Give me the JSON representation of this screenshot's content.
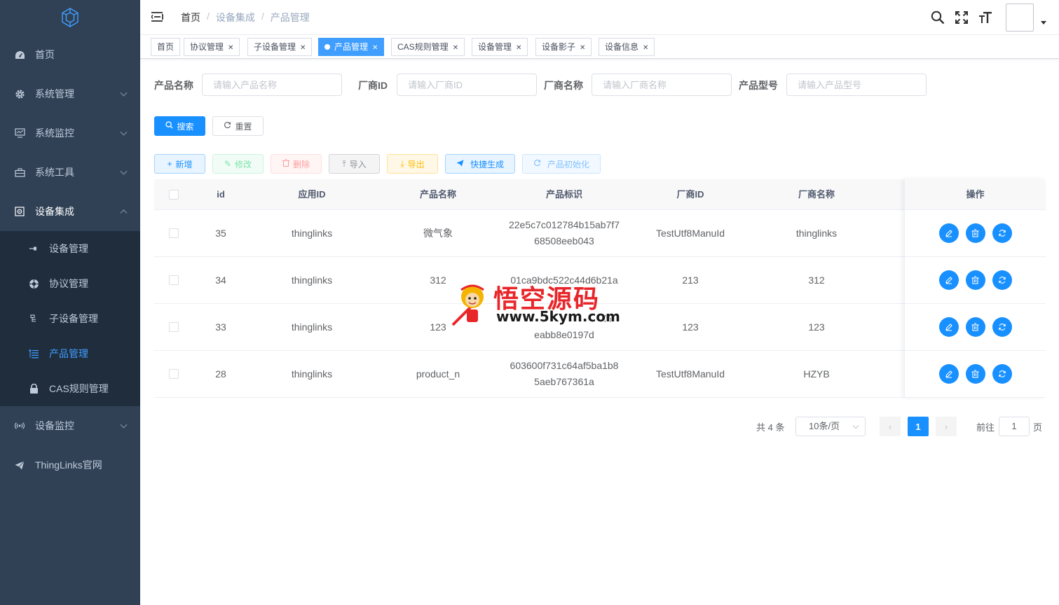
{
  "sidebar": {
    "menu": [
      {
        "label": "首页",
        "icon": "dashboard-icon"
      },
      {
        "label": "系统管理",
        "icon": "gear-icon"
      },
      {
        "label": "系统监控",
        "icon": "monitor-icon"
      },
      {
        "label": "系统工具",
        "icon": "toolbox-icon"
      },
      {
        "label": "设备集成",
        "icon": "device-icon"
      }
    ],
    "submenu": [
      {
        "label": "设备管理",
        "icon": "plug-icon"
      },
      {
        "label": "协议管理",
        "icon": "protocol-icon"
      },
      {
        "label": "子设备管理",
        "icon": "sub-device-icon"
      },
      {
        "label": "产品管理",
        "icon": "tree-list-icon"
      },
      {
        "label": "CAS规则管理",
        "icon": "lock-icon"
      }
    ],
    "after": [
      {
        "label": "设备监控",
        "icon": "signal-icon"
      },
      {
        "label": "ThingLinks官网",
        "icon": "send-icon"
      }
    ]
  },
  "breadcrumb": [
    "首页",
    "设备集成",
    "产品管理"
  ],
  "tags": [
    {
      "label": "首页"
    },
    {
      "label": "协议管理"
    },
    {
      "label": "子设备管理"
    },
    {
      "label": "产品管理"
    },
    {
      "label": "CAS规则管理"
    },
    {
      "label": "设备管理"
    },
    {
      "label": "设备影子"
    },
    {
      "label": "设备信息"
    }
  ],
  "search": {
    "product_name": {
      "label": "产品名称",
      "placeholder": "请输入产品名称"
    },
    "manufacturer_id": {
      "label": "厂商ID",
      "placeholder": "请输入厂商ID"
    },
    "manufacturer_name": {
      "label": "厂商名称",
      "placeholder": "请输入厂商名称"
    },
    "model": {
      "label": "产品型号",
      "placeholder": "请输入产品型号"
    },
    "search_btn": "搜索",
    "reset_btn": "重置"
  },
  "toolbar": {
    "add": "新增",
    "edit": "修改",
    "delete": "删除",
    "import": "导入",
    "export": "导出",
    "quick": "快捷生成",
    "init": "产品初始化"
  },
  "table": {
    "headers": [
      "id",
      "应用ID",
      "产品名称",
      "产品标识",
      "厂商ID",
      "厂商名称",
      "操作"
    ],
    "rows": [
      {
        "id": "35",
        "app": "thinglinks",
        "name": "微气象",
        "ident1": "22e5c7c012784b15ab7f7",
        "ident2": "68508eeb043",
        "mid": "TestUtf8ManuId",
        "mname": "thinglinks"
      },
      {
        "id": "34",
        "app": "thinglinks",
        "name": "312",
        "ident1": "01ca9bdc522c44d6b21a",
        "ident2": "",
        "mid": "213",
        "mname": "312"
      },
      {
        "id": "33",
        "app": "thinglinks",
        "name": "123",
        "ident1": "f5f",
        "ident2": "eabb8e0197d",
        "mid": "123",
        "mname": "123"
      },
      {
        "id": "28",
        "app": "thinglinks",
        "name": "product_n",
        "ident1": "603600f731c64af5ba1b8",
        "ident2": "5aeb767361a",
        "mid": "TestUtf8ManuId",
        "mname": "HZYB"
      }
    ]
  },
  "pagination": {
    "total": "共 4 条",
    "page_size": "10条/页",
    "current": "1",
    "goto_label": "前往",
    "goto_value": "1",
    "page_suffix": "页"
  },
  "watermark": {
    "title": "悟空源码",
    "url": "www.5kym.com"
  },
  "colors": {
    "sidebar": "#304156",
    "submenu": "#1f2d3d",
    "primary": "#1890ff",
    "active_text": "#409eff"
  }
}
